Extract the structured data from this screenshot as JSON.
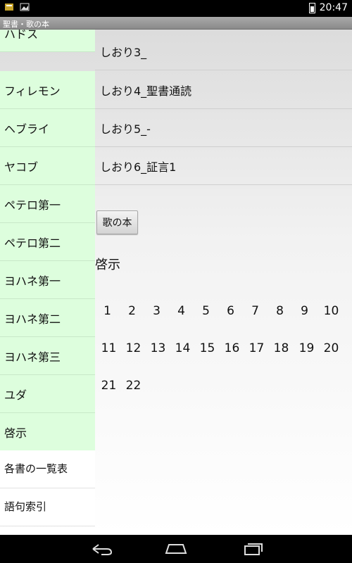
{
  "status_bar": {
    "time": "20:47"
  },
  "title_bar": {
    "title": "聖書・歌の本"
  },
  "sidebar": {
    "items": [
      "ハドス",
      "フィレモン",
      "ヘブライ",
      "ヤコブ",
      "ペテロ第一",
      "ペテロ第二",
      "ヨハネ第一",
      "ヨハネ第二",
      "ヨハネ第三",
      "ユダ",
      "啓示"
    ],
    "extra_items": [
      "各書の一覧表",
      "語句索引"
    ]
  },
  "main": {
    "bookmarks": [
      "しおり3_",
      "しおり4_聖書通読",
      "しおり5_-",
      "しおり6_証言1"
    ],
    "song_button": "歌の本",
    "book_name": "啓示",
    "chapters": [
      "1",
      "2",
      "3",
      "4",
      "5",
      "6",
      "7",
      "8",
      "9",
      "10",
      "11",
      "12",
      "13",
      "14",
      "15",
      "16",
      "17",
      "18",
      "19",
      "20",
      "21",
      "22"
    ]
  }
}
